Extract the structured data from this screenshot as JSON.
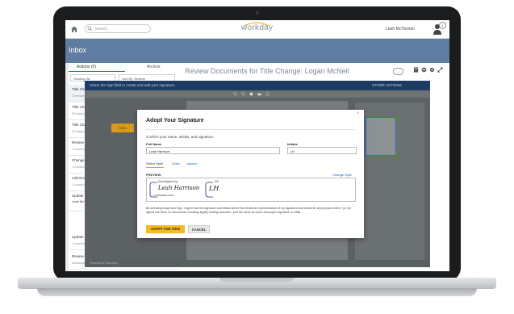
{
  "header": {
    "search_placeholder": "search",
    "logo": "workday",
    "user_name": "Leah McTiernan",
    "notification_count": "1"
  },
  "inbox": {
    "title": "Inbox",
    "tabs": [
      {
        "label": "Actions (0)"
      },
      {
        "label": "Archive"
      }
    ],
    "viewing": "Viewing: All",
    "sort_by": "Sort By: Newest",
    "items": [
      {
        "title": "Title Change",
        "sub": "2 minute(s) ago"
      },
      {
        "title": "Title Change",
        "sub": "29 day(s) ago"
      },
      {
        "title": "Title Change",
        "sub": "29 day(s) ago"
      },
      {
        "title": "Review Doc",
        "sub": "1 month(s) ago"
      },
      {
        "title": "Change My",
        "sub": "1 month(s) ago"
      },
      {
        "title": "Add Emerge",
        "sub": "1 month(s) ago"
      },
      {
        "title": "Update Per",
        "sub": "Leah McTie"
      },
      {
        "title": "Update You",
        "sub": "1 month(s) ago"
      },
      {
        "title": "Review Nam",
        "sub": "Administrat"
      }
    ]
  },
  "review": {
    "prefix": "Review Documents",
    "title": "Review Documents for Title Change: Logan McNeil",
    "more": "..."
  },
  "docusign": {
    "bar_text": "Select the sign field to create and add your signature.",
    "other_actions": "OTHER ACTIONS",
    "sign_tag": "SIGN",
    "footer": "Powered by DocuSign",
    "thumb_title": "Title Change Form.pdf"
  },
  "modal": {
    "title": "Adopt Your Signature",
    "description": "Confirm your name, initials, and signature.",
    "full_name_label": "Full Name",
    "full_name_value": "Leah Harrison",
    "initials_label": "Initials",
    "initials_value": "LH",
    "tabs": [
      "Select Style",
      "Draw",
      "Upload"
    ],
    "preview_label": "PREVIEW",
    "change_style": "Change Style",
    "signature": {
      "docusigned_by": "DocuSigned by:",
      "script_name": "Leah Harrison",
      "hash": "17C6F8D6EF73946...",
      "ds_label": "DS",
      "script_initials": "LH"
    },
    "legal_text": "By selecting Adopt and Sign, I agree that the signature and initials will be the electronic representation of my signature and initials for all purposes when I (or my agent) use them on documents, including legally binding contracts - just the same as a pen-and-paper signature or initial.",
    "adopt_button": "ADOPT AND SIGN",
    "cancel_button": "CANCEL"
  }
}
